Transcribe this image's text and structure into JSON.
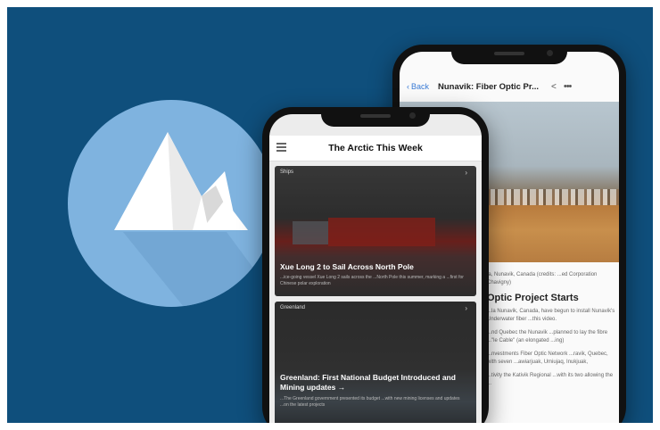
{
  "colors": {
    "background": "#0f4f7c",
    "logo_circle": "#7fb3df",
    "link": "#3a7bd5"
  },
  "logo": {
    "icon": "mountain-icon"
  },
  "back_phone": {
    "nav": {
      "back_label": "Back",
      "title": "Nunavik: Fiber Optic Pr...",
      "share_icon": "share-icon",
      "more_icon": "more-icon"
    },
    "article": {
      "lead": "la, Nunavik, Canada (credits: ...ed Corporation Chavigny)",
      "heading": "Optic Project Starts",
      "paragraphs": [
        "...la Nunavik, Canada, have begun to install Nunavik's Underwater fiber ...this video.",
        "...nd Quebec the Nunavik ...planned to lay the fibre ...\"le Cable\" (an elongated ...ing)",
        "...nvestments Fiber Optic Network ...ravik, Quebec, with seven ...awiarjuak, Umiujaq, Inukjuak,",
        "...tivity the Kativik Regional ...with its two allowing the ..."
      ]
    }
  },
  "front_phone": {
    "header": {
      "title": "The Arctic This Week",
      "menu_icon": "hamburger-menu-icon"
    },
    "cards": [
      {
        "tag": "Ships",
        "headline": "Xue Long 2 to Sail Across North Pole",
        "sub": "...ice-going vessel Xue Long 2 sails across the ...North Pole this summer, marking a ...first for Chinese polar exploration",
        "arrow": "›"
      },
      {
        "tag": "Greenland",
        "headline": "Greenland: First National Budget Introduced and Mining updates →",
        "sub": "...The Greenland government presented its budget ...with new mining licenses and updates ...on the latest projects",
        "arrow": "›"
      }
    ]
  }
}
